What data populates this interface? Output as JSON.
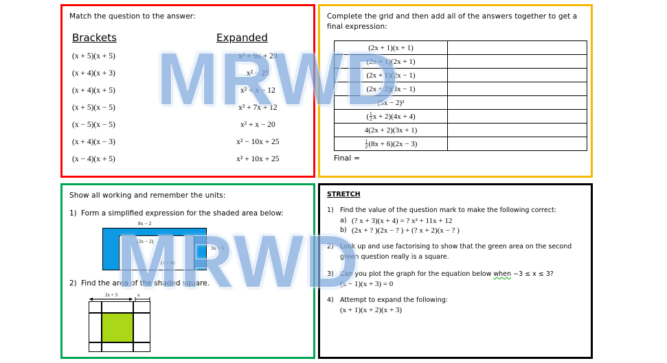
{
  "watermark": {
    "text": "MRWD",
    "color": "#7fa9dd"
  },
  "panels": {
    "match": {
      "border_color": "#ff0000",
      "prompt": "Match the question to the answer:",
      "col_headers": {
        "left": "Brackets",
        "right": "Expanded"
      },
      "rows": [
        {
          "bracket": "(x + 5)(x + 5)",
          "expanded": "x² + 9x + 20"
        },
        {
          "bracket": "(x + 4)(x + 3)",
          "expanded": "x² − 25"
        },
        {
          "bracket": "(x + 4)(x + 5)",
          "expanded": "x² + x − 12"
        },
        {
          "bracket": "(x + 5)(x − 5)",
          "expanded": "x² + 7x + 12"
        },
        {
          "bracket": "(x − 5)(x − 5)",
          "expanded": "x² + x − 20"
        },
        {
          "bracket": "(x + 4)(x − 3)",
          "expanded": "x² − 10x + 25"
        },
        {
          "bracket": "(x − 4)(x + 5)",
          "expanded": "x² + 10x + 25"
        }
      ]
    },
    "grid": {
      "border_color": "#f5b800",
      "prompt": "Complete the grid and then add all of the answers together to get a final expression:",
      "rows": [
        "(2x + 1)(x + 1)",
        "(2x + 1)(2x + 1)",
        "(2x + 1)(2x − 1)",
        "(2x + 2)(3x − 1)",
        "(5x − 2)²",
        "FRACTION_ROW",
        "4(2x + 2)(3x + 1)",
        "HALF_ROW"
      ],
      "fraction_row": {
        "prefix": "",
        "frac_num": "1",
        "frac_den": "2",
        "after_frac": "x + 2",
        "tail": "(4x + 4)"
      },
      "half_row": {
        "frac_num": "1",
        "frac_den": "2",
        "tail": "(8x + 6)(2x − 3)"
      },
      "final_label": "Final ="
    },
    "working": {
      "border_color": "#00a651",
      "prompt": "Show all working and remember the units:",
      "questions": [
        {
          "num": "1)",
          "text": "Form a simplified expression for the shaded area below:"
        },
        {
          "num": "2)",
          "text": "Find the area of the shaded square."
        }
      ],
      "figure1": {
        "top_label": "8x − 2",
        "right_label": "3x + 5",
        "inner_label_top": "(2x − 2)",
        "inner_label_bottom": "(x + 4)",
        "shade_color": "#0d9ae5"
      },
      "figure2": {
        "dim_label_wide": "2x + 3",
        "dim_label_narrow": "x",
        "shade_color": "#aad819"
      }
    },
    "stretch": {
      "border_color": "#000000",
      "title": "STRETCH",
      "items": [
        {
          "num": "1)",
          "text": "Find the value of the question mark to make the following correct:",
          "subs": [
            {
              "label": "a)",
              "eq": "(? x + 3)(x + 4) = ? x² + 11x + 12"
            },
            {
              "label": "b)",
              "eq": "(2x + ? )(2x − ? ) + (? x + 2)(x − ? )"
            }
          ]
        },
        {
          "num": "2)",
          "text": "Look up and use factorising to show that the green area on the second green question really is a square."
        },
        {
          "num": "3)",
          "text_pre": "Can you plot the graph for the equation below ",
          "text_wavy": "when",
          "text_post": " −3 ≤ x ≤ 3?",
          "eq": "(x − 1)(x + 3) = 0"
        },
        {
          "num": "4)",
          "text": "Attempt to expand the following:",
          "eq": "(x + 1)(x + 2)(x + 3)"
        }
      ]
    }
  }
}
